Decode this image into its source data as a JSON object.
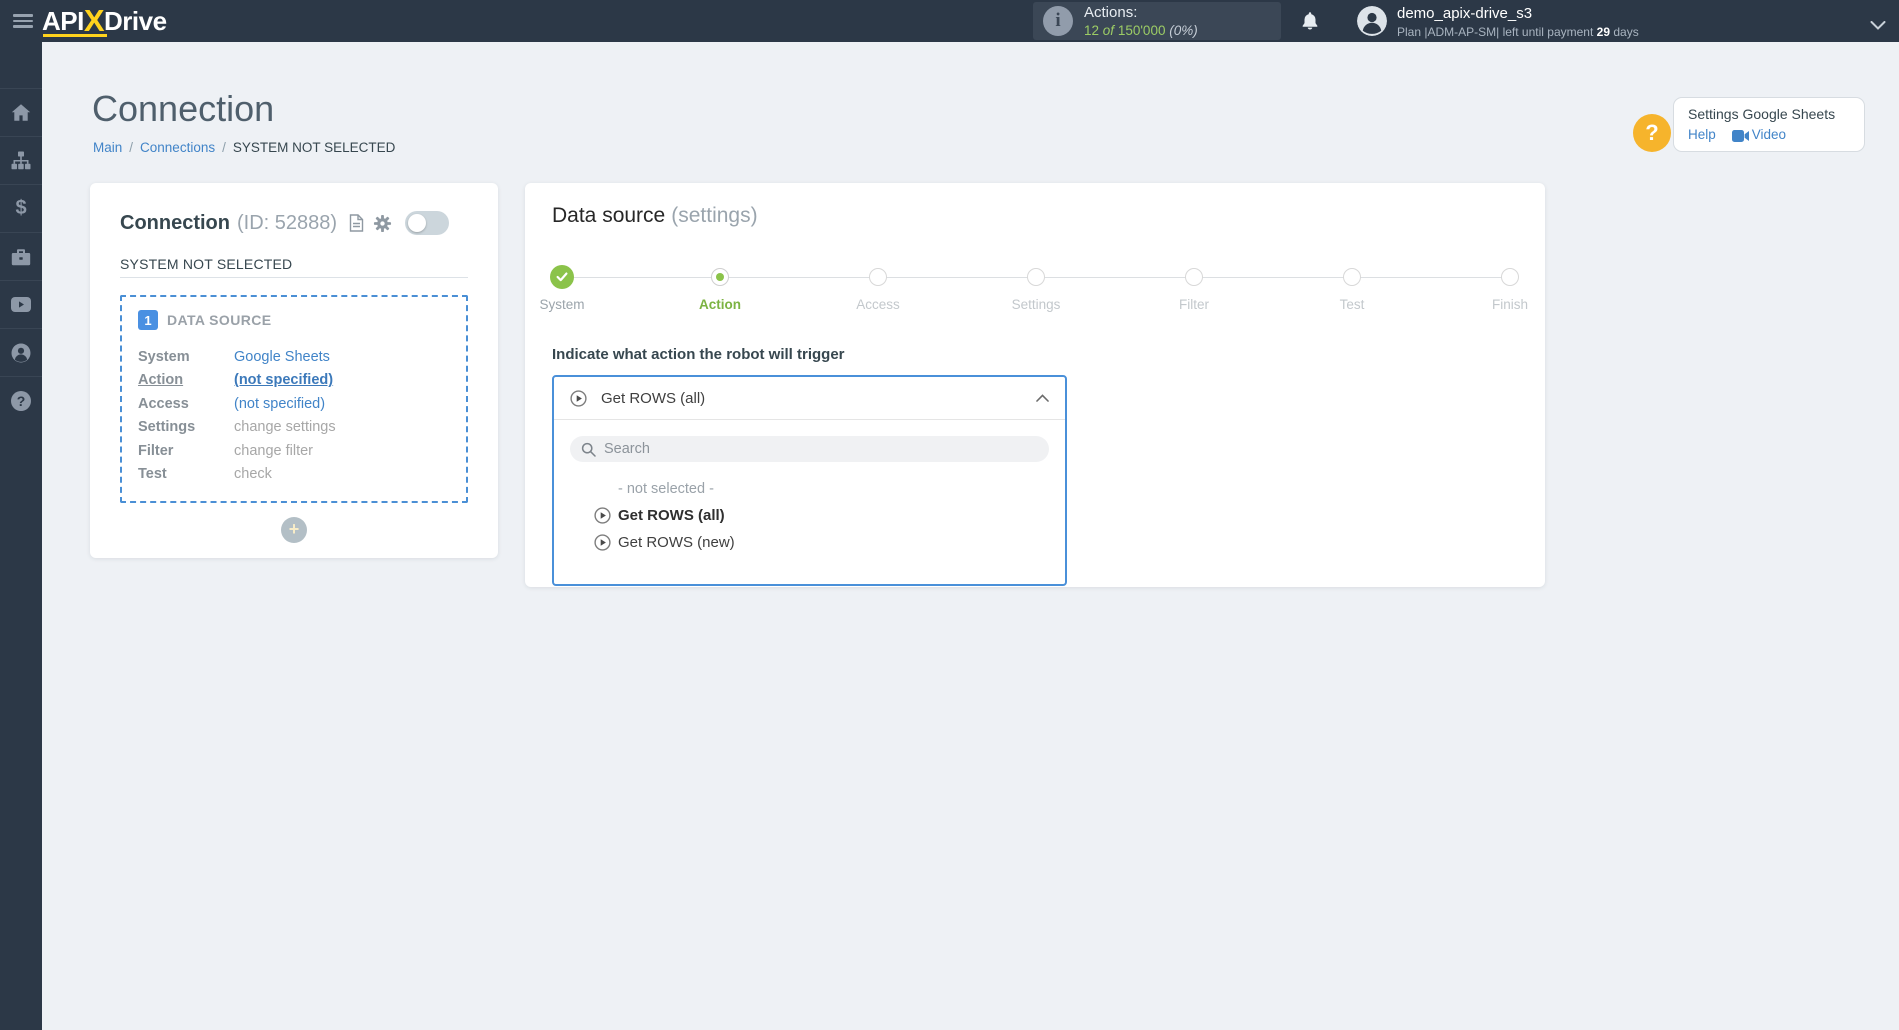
{
  "header": {
    "logo": {
      "api": "API",
      "x": "X",
      "drive": "Drive"
    },
    "actions_counter": {
      "label": "Actions:",
      "used": "12",
      "of": "of",
      "total": "150'000",
      "percent": "(0%)"
    },
    "user": {
      "name": "demo_apix-drive_s3",
      "plan_prefix": "Plan |ADM-AP-SM| left until payment",
      "days": "29",
      "days_word": "days"
    }
  },
  "sidebar": {
    "items": [
      {
        "icon": "home"
      },
      {
        "icon": "sitemap"
      },
      {
        "icon": "dollar"
      },
      {
        "icon": "briefcase"
      },
      {
        "icon": "video"
      },
      {
        "icon": "user"
      },
      {
        "icon": "help"
      }
    ],
    "dollar_glyph": "$",
    "help_glyph": "?"
  },
  "page": {
    "title": "Connection",
    "breadcrumb": {
      "main": "Main",
      "sep": "/",
      "connections": "Connections",
      "current": "SYSTEM NOT SELECTED"
    }
  },
  "help_widget": {
    "question_glyph": "?",
    "title": "Settings Google Sheets",
    "help": "Help",
    "video": "Video"
  },
  "connection_card": {
    "title": "Connection",
    "id": "(ID: 52888)",
    "status": "SYSTEM NOT SELECTED",
    "badge": "1",
    "section": "DATA SOURCE",
    "rows": [
      {
        "label": "System",
        "value": "Google Sheets"
      },
      {
        "label": "Action",
        "value": "(not specified)"
      },
      {
        "label": "Access",
        "value": "(not specified)"
      },
      {
        "label": "Settings",
        "value": "change settings"
      },
      {
        "label": "Filter",
        "value": "change filter"
      },
      {
        "label": "Test",
        "value": "check"
      }
    ],
    "add_label": "+"
  },
  "source_card": {
    "title": "Data source",
    "subtitle": "(settings)",
    "steps": [
      {
        "label": "System",
        "state": "done"
      },
      {
        "label": "Action",
        "state": "current"
      },
      {
        "label": "Access",
        "state": "todo"
      },
      {
        "label": "Settings",
        "state": "todo"
      },
      {
        "label": "Filter",
        "state": "todo"
      },
      {
        "label": "Test",
        "state": "todo"
      },
      {
        "label": "Finish",
        "state": "todo"
      }
    ],
    "question": "Indicate what action the robot will trigger",
    "dropdown": {
      "selected": "Get ROWS (all)",
      "search_placeholder": "Search",
      "options": [
        {
          "label": "- not selected -"
        },
        {
          "label": "Get ROWS (all)"
        },
        {
          "label": "Get ROWS (new)"
        }
      ]
    }
  },
  "colors": {
    "header_bg": "#2c3847",
    "accent_blue": "#4184c8",
    "accent_green": "#8bc34a",
    "brand_yellow": "#ffd31d",
    "badge_blue": "#4a90e2",
    "help_yellow": "#f6b42c"
  }
}
